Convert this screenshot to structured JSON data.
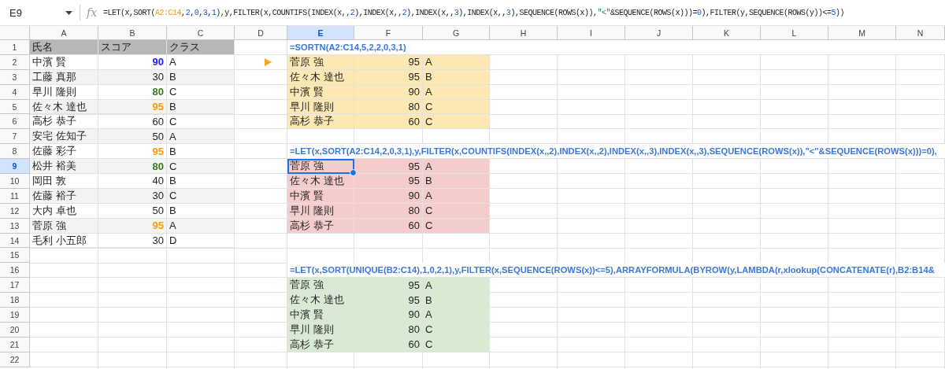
{
  "name_box": {
    "text": "E9"
  },
  "function_label": "fx",
  "formula_bar": {
    "segments": [
      {
        "text": "=LET(x,SORT(",
        "kind": "plain"
      },
      {
        "text": "A2:C14",
        "kind": "ref"
      },
      {
        "text": ",",
        "kind": "plain"
      },
      {
        "text": "2",
        "kind": "number"
      },
      {
        "text": ",",
        "kind": "plain"
      },
      {
        "text": "0",
        "kind": "number"
      },
      {
        "text": ",",
        "kind": "plain"
      },
      {
        "text": "3",
        "kind": "number"
      },
      {
        "text": ",",
        "kind": "plain"
      },
      {
        "text": "1",
        "kind": "number"
      },
      {
        "text": "),y,FILTER(x,COUNTIFS(INDEX(x,,",
        "kind": "plain"
      },
      {
        "text": "2",
        "kind": "number"
      },
      {
        "text": "),INDEX(x,,",
        "kind": "plain"
      },
      {
        "text": "2",
        "kind": "number"
      },
      {
        "text": "),INDEX(x,,",
        "kind": "plain"
      },
      {
        "text": "3",
        "kind": "number"
      },
      {
        "text": "),INDEX(x,,",
        "kind": "plain"
      },
      {
        "text": "3",
        "kind": "number"
      },
      {
        "text": "),SEQUENCE(ROWS(x)),",
        "kind": "plain"
      },
      {
        "text": "\"<\"",
        "kind": "string"
      },
      {
        "text": "&SEQUENCE(ROWS(x)))=",
        "kind": "plain"
      },
      {
        "text": "0",
        "kind": "number"
      },
      {
        "text": "),FILTER(y,SEQUENCE(ROWS(y))<=",
        "kind": "plain"
      },
      {
        "text": "5",
        "kind": "number"
      },
      {
        "text": "))",
        "kind": "plain"
      }
    ]
  },
  "columns": [
    {
      "label": "A",
      "selected": false
    },
    {
      "label": "B",
      "selected": false
    },
    {
      "label": "C",
      "selected": false
    },
    {
      "label": "D",
      "selected": false
    },
    {
      "label": "E",
      "selected": true
    },
    {
      "label": "F",
      "selected": false
    },
    {
      "label": "G",
      "selected": false
    },
    {
      "label": "H",
      "selected": false
    },
    {
      "label": "I",
      "selected": false
    },
    {
      "label": "J",
      "selected": false
    },
    {
      "label": "K",
      "selected": false
    },
    {
      "label": "L",
      "selected": false
    },
    {
      "label": "M",
      "selected": false
    },
    {
      "label": "N",
      "selected": false
    }
  ],
  "rows": [
    {
      "number": "1",
      "selected": false,
      "cells": [
        {
          "text": "氏名",
          "header": true
        },
        {
          "text": "スコア",
          "header": true
        },
        {
          "text": "クラス",
          "header": true
        },
        null,
        {
          "text": "=SORTN(A2:C14,5,2,2,0,3,1)",
          "kind": "formula"
        }
      ]
    },
    {
      "number": "2",
      "selected": false,
      "cells": [
        {
          "text": "中濱 賢"
        },
        {
          "text": "90",
          "kind": "number",
          "color": "#1a1aff"
        },
        {
          "text": "A"
        },
        {
          "kind": "marker"
        },
        {
          "text": "菅原 強",
          "kind": "result",
          "color": "#fce8b2"
        },
        {
          "text": "95",
          "kind": "result_number",
          "color": "#fce8b2"
        },
        {
          "text": "A",
          "kind": "result",
          "color": "#fce8b2"
        }
      ]
    },
    {
      "number": "3",
      "selected": false,
      "cells": [
        {
          "text": "工藤 真那",
          "shaded": true
        },
        {
          "text": "30",
          "kind": "number",
          "shaded": true
        },
        {
          "text": "B",
          "shaded": true
        },
        null,
        {
          "text": "佐々木 達也",
          "kind": "result",
          "color": "#fce8b2"
        },
        {
          "text": "95",
          "kind": "result_number",
          "color": "#fce8b2"
        },
        {
          "text": "B",
          "kind": "result",
          "color": "#fce8b2"
        }
      ]
    },
    {
      "number": "4",
      "selected": false,
      "cells": [
        {
          "text": "早川 隆則"
        },
        {
          "text": "80",
          "kind": "number",
          "color": "#38761d"
        },
        {
          "text": "C"
        },
        null,
        {
          "text": "中濱 賢",
          "kind": "result",
          "color": "#fce8b2"
        },
        {
          "text": "90",
          "kind": "result_number",
          "color": "#fce8b2"
        },
        {
          "text": "A",
          "kind": "result",
          "color": "#fce8b2"
        }
      ]
    },
    {
      "number": "5",
      "selected": false,
      "cells": [
        {
          "text": "佐々木 達也",
          "shaded": true
        },
        {
          "text": "95",
          "kind": "number",
          "shaded": true,
          "color": "#ff9900"
        },
        {
          "text": "B",
          "shaded": true
        },
        null,
        {
          "text": "早川 隆則",
          "kind": "result",
          "color": "#fce8b2"
        },
        {
          "text": "80",
          "kind": "result_number",
          "color": "#fce8b2"
        },
        {
          "text": "C",
          "kind": "result",
          "color": "#fce8b2"
        }
      ]
    },
    {
      "number": "6",
      "selected": false,
      "cells": [
        {
          "text": "高杉 恭子"
        },
        {
          "text": "60",
          "kind": "number"
        },
        {
          "text": "C"
        },
        null,
        {
          "text": "高杉 恭子",
          "kind": "result",
          "color": "#fce8b2"
        },
        {
          "text": "60",
          "kind": "result_number",
          "color": "#fce8b2"
        },
        {
          "text": "C",
          "kind": "result",
          "color": "#fce8b2"
        }
      ]
    },
    {
      "number": "7",
      "selected": false,
      "cells": [
        {
          "text": "安宅 佐知子",
          "shaded": true
        },
        {
          "text": "50",
          "kind": "number",
          "shaded": true
        },
        {
          "text": "A",
          "shaded": true
        }
      ]
    },
    {
      "number": "8",
      "selected": false,
      "cells": [
        {
          "text": "佐藤 彩子"
        },
        {
          "text": "95",
          "kind": "number",
          "color": "#ff9900"
        },
        {
          "text": "B"
        },
        null,
        {
          "text": "=LET(x,SORT(A2:C14,2,0,3,1),y,FILTER(x,COUNTIFS(INDEX(x,,2),INDEX(x,,2),INDEX(x,,3),INDEX(x,,3),SEQUENCE(ROWS(x)),\"<\"&SEQUENCE(ROWS(x)))=0),",
          "kind": "formula"
        }
      ]
    },
    {
      "number": "9",
      "selected": true,
      "cells": [
        {
          "text": "松井 裕美",
          "shaded": true
        },
        {
          "text": "80",
          "kind": "number",
          "shaded": true,
          "color": "#38761d"
        },
        {
          "text": "C",
          "shaded": true
        },
        null,
        {
          "text": "菅原 強",
          "kind": "result",
          "color": "#f4cccc"
        },
        {
          "text": "95",
          "kind": "result_number",
          "color": "#f4cccc"
        },
        {
          "text": "A",
          "kind": "result",
          "color": "#f4cccc"
        }
      ]
    },
    {
      "number": "10",
      "selected": false,
      "cells": [
        {
          "text": "岡田 敦"
        },
        {
          "text": "40",
          "kind": "number"
        },
        {
          "text": "B"
        },
        null,
        {
          "text": "佐々木 達也",
          "kind": "result",
          "color": "#f4cccc"
        },
        {
          "text": "95",
          "kind": "result_number",
          "color": "#f4cccc"
        },
        {
          "text": "B",
          "kind": "result",
          "color": "#f4cccc"
        }
      ]
    },
    {
      "number": "11",
      "selected": false,
      "cells": [
        {
          "text": "佐藤 裕子",
          "shaded": true
        },
        {
          "text": "30",
          "kind": "number",
          "shaded": true
        },
        {
          "text": "C",
          "shaded": true
        },
        null,
        {
          "text": "中濱 賢",
          "kind": "result",
          "color": "#f4cccc"
        },
        {
          "text": "90",
          "kind": "result_number",
          "color": "#f4cccc"
        },
        {
          "text": "A",
          "kind": "result",
          "color": "#f4cccc"
        }
      ]
    },
    {
      "number": "12",
      "selected": false,
      "cells": [
        {
          "text": "大内 卓也"
        },
        {
          "text": "50",
          "kind": "number"
        },
        {
          "text": "B"
        },
        null,
        {
          "text": "早川 隆則",
          "kind": "result",
          "color": "#f4cccc"
        },
        {
          "text": "80",
          "kind": "result_number",
          "color": "#f4cccc"
        },
        {
          "text": "C",
          "kind": "result",
          "color": "#f4cccc"
        }
      ]
    },
    {
      "number": "13",
      "selected": false,
      "cells": [
        {
          "text": "菅原 強",
          "shaded": true
        },
        {
          "text": "95",
          "kind": "number",
          "shaded": true,
          "color": "#ff9900"
        },
        {
          "text": "A",
          "shaded": true
        },
        null,
        {
          "text": "高杉 恭子",
          "kind": "result",
          "color": "#f4cccc"
        },
        {
          "text": "60",
          "kind": "result_number",
          "color": "#f4cccc"
        },
        {
          "text": "C",
          "kind": "result",
          "color": "#f4cccc"
        }
      ]
    },
    {
      "number": "14",
      "selected": false,
      "cells": [
        {
          "text": "毛利 小五郎"
        },
        {
          "text": "30",
          "kind": "number"
        },
        {
          "text": "D"
        }
      ]
    },
    {
      "number": "15",
      "selected": false
    },
    {
      "number": "16",
      "selected": false,
      "cells": [
        null,
        null,
        null,
        null,
        {
          "text": "=LET(x,SORT(UNIQUE(B2:C14),1,0,2,1),y,FILTER(x,SEQUENCE(ROWS(x))<=5),ARRAYFORMULA(BYROW(y,LAMBDA(r,xlookup(CONCATENATE(r),B2:B14&",
          "kind": "formula"
        }
      ]
    },
    {
      "number": "17",
      "selected": false,
      "cells": [
        null,
        null,
        null,
        null,
        {
          "text": "菅原 強",
          "kind": "result",
          "color": "#d9ead3"
        },
        {
          "text": "95",
          "kind": "result_number",
          "color": "#d9ead3"
        },
        {
          "text": "A",
          "kind": "result",
          "color": "#d9ead3"
        }
      ]
    },
    {
      "number": "18",
      "selected": false,
      "cells": [
        null,
        null,
        null,
        null,
        {
          "text": "佐々木 達也",
          "kind": "result",
          "color": "#d9ead3"
        },
        {
          "text": "95",
          "kind": "result_number",
          "color": "#d9ead3"
        },
        {
          "text": "B",
          "kind": "result",
          "color": "#d9ead3"
        }
      ]
    },
    {
      "number": "19",
      "selected": false,
      "cells": [
        null,
        null,
        null,
        null,
        {
          "text": "中濱 賢",
          "kind": "result",
          "color": "#d9ead3"
        },
        {
          "text": "90",
          "kind": "result_number",
          "color": "#d9ead3"
        },
        {
          "text": "A",
          "kind": "result",
          "color": "#d9ead3"
        }
      ]
    },
    {
      "number": "20",
      "selected": false,
      "cells": [
        null,
        null,
        null,
        null,
        {
          "text": "早川 隆則",
          "kind": "result",
          "color": "#d9ead3"
        },
        {
          "text": "80",
          "kind": "result_number",
          "color": "#d9ead3"
        },
        {
          "text": "C",
          "kind": "result",
          "color": "#d9ead3"
        }
      ]
    },
    {
      "number": "21",
      "selected": false,
      "cells": [
        null,
        null,
        null,
        null,
        {
          "text": "高杉 恭子",
          "kind": "result",
          "color": "#d9ead3"
        },
        {
          "text": "60",
          "kind": "result_number",
          "color": "#d9ead3"
        },
        {
          "text": "C",
          "kind": "result",
          "color": "#d9ead3"
        }
      ]
    },
    {
      "number": "22",
      "selected": false
    }
  ]
}
